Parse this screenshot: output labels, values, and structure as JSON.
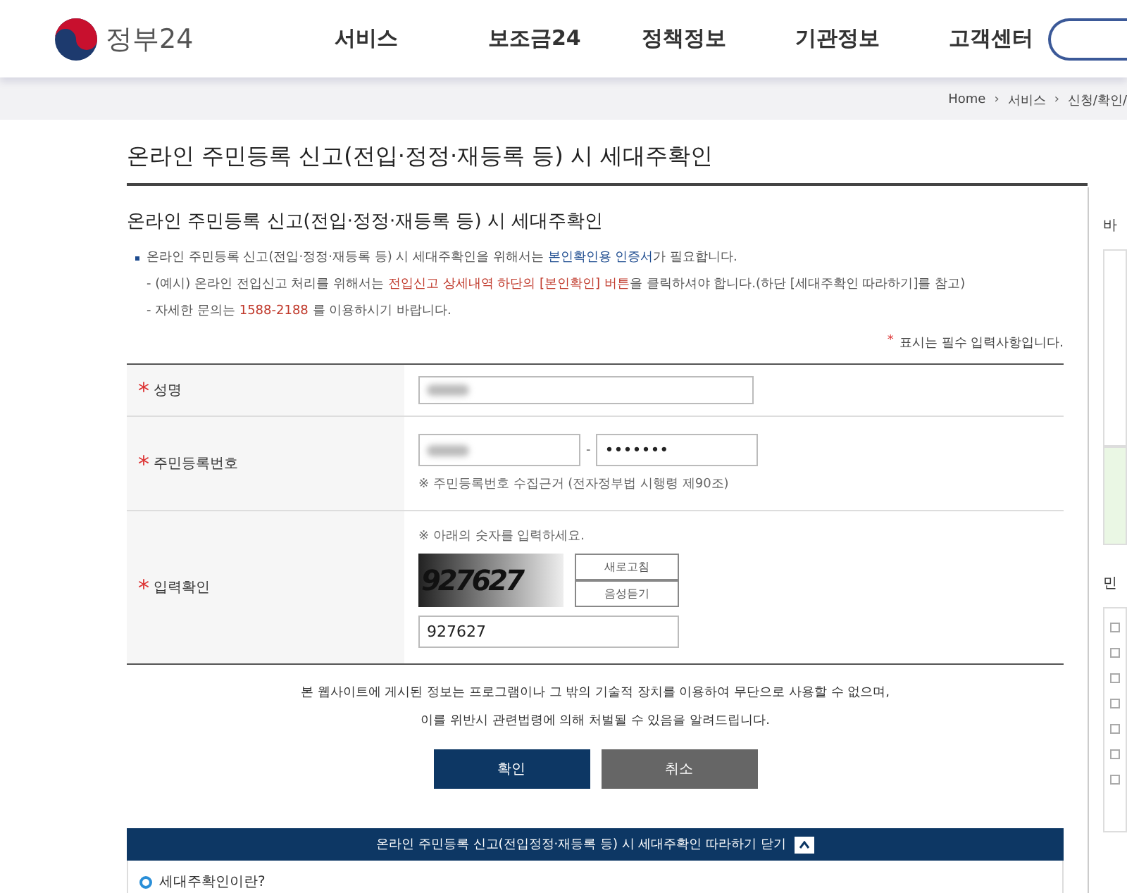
{
  "header": {
    "logo_text": "정부24",
    "nav": [
      {
        "label": "서비스"
      },
      {
        "label": "보조금24"
      },
      {
        "label": "정책정보"
      },
      {
        "label": "기관정보"
      },
      {
        "label": "고객센터"
      }
    ]
  },
  "breadcrumb": [
    "Home",
    "서비스",
    "신청/확인/"
  ],
  "breadcrumb_separator": "›",
  "page_title": "온라인 주민등록 신고(전입·정정·재등록 등) 시 세대주확인",
  "section": {
    "title": "온라인 주민등록 신고(전입·정정·재등록 등) 시 세대주확인",
    "notes": [
      {
        "kind": "bullet",
        "segments": [
          {
            "text": "온라인 주민등록 신고(전입·정정·재등록 등) 시 세대주확인을 위해서는 ",
            "color": "#555555"
          },
          {
            "text": "본인확인용 인증서",
            "color": "#1d4b8f"
          },
          {
            "text": "가 필요합니다.",
            "color": "#555555"
          }
        ]
      },
      {
        "kind": "dash",
        "segments": [
          {
            "text": "- (예시) 온라인 전입신고 처리를 위해서는 ",
            "color": "#555555"
          },
          {
            "text": "전입신고 상세내역 하단의 [본인확인] 버튼",
            "color": "#c0392b"
          },
          {
            "text": "을 클릭하셔야 합니다.(하단 [세대주확인 따라하기]를 참고)",
            "color": "#555555"
          }
        ]
      },
      {
        "kind": "dash",
        "segments": [
          {
            "text": "- 자세한 문의는 ",
            "color": "#555555"
          },
          {
            "text": "1588-2188",
            "color": "#c0392b"
          },
          {
            "text": " 를 이용하시기 바랍니다.",
            "color": "#555555"
          }
        ]
      }
    ],
    "required_mark": "*",
    "required_note": "표시는 필수 입력사항입니다."
  },
  "form": {
    "rows": [
      {
        "kind": "name",
        "label": "성명",
        "required": true
      },
      {
        "kind": "rrn",
        "label": "주민등록번호",
        "required": true,
        "separator": "-",
        "masked_value": "•••••••",
        "note": "※ 주민등록번호 수집근거 (전자정부법 시행령 제90조)"
      },
      {
        "kind": "captcha",
        "label": "입력확인",
        "required": true,
        "note": "※ 아래의 숫자를 입력하세요.",
        "captcha_text": "927627",
        "buttons": [
          "새로고침",
          "음성듣기"
        ],
        "value": "927627"
      }
    ]
  },
  "notice": [
    "본 웹사이트에 게시된 정보는 프로그램이나 그 밖의 기술적 장치를 이용하여 무단으로 사용할 수 없으며,",
    "이를 위반시 관련법령에 의해 처벌될 수 있음을 알려드립니다."
  ],
  "buttons": [
    {
      "label": "확인",
      "kind": "primary"
    },
    {
      "label": "취소",
      "kind": "secondary"
    }
  ],
  "guide": {
    "title": "온라인 주민등록 신고(전입정정·재등록 등) 시 세대주확인 따라하기 닫기",
    "expanded": true,
    "first_item": "세대주확인이란?"
  },
  "sidebar": {
    "headings": [
      "바",
      "민"
    ]
  }
}
